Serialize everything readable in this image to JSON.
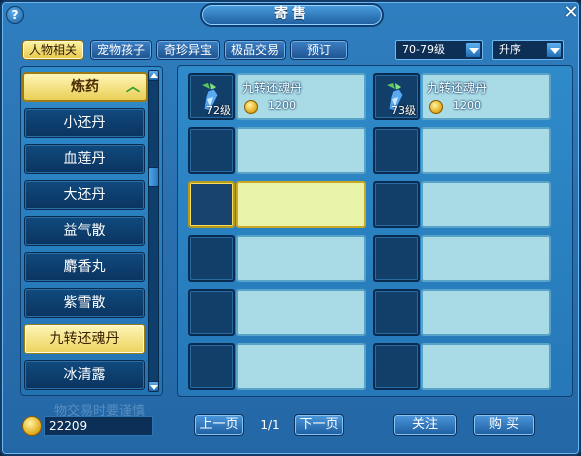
{
  "window": {
    "title": "寄售"
  },
  "tabs": [
    "人物相关",
    "宠物孩子",
    "奇珍异宝",
    "极品交易",
    "预订"
  ],
  "filters": {
    "level_range": "70-79级",
    "sort_order": "升序"
  },
  "category": {
    "header": "炼药",
    "items": [
      "小还丹",
      "血莲丹",
      "大还丹",
      "益气散",
      "麝香丸",
      "紫雪散",
      "九转还魂丹",
      "冰清露"
    ],
    "selected": "九转还魂丹"
  },
  "listings": [
    {
      "name": "九转还魂丹",
      "level": "72级",
      "price": "1200"
    },
    {
      "name": "九转还魂丹",
      "level": "73级",
      "price": "1200"
    }
  ],
  "footer": {
    "money": "22209",
    "prev_page": "上一页",
    "page_indicator": "1/1",
    "next_page": "下一页",
    "follow": "关注",
    "buy": "购  买",
    "watermark": "物交易时要谨慎"
  },
  "colors": {
    "accent_gold": "#e9cf55",
    "panel_blue": "#2a6fae",
    "slot_cyan": "#a9dbe6",
    "selected_slot": "#e8f2a8"
  }
}
